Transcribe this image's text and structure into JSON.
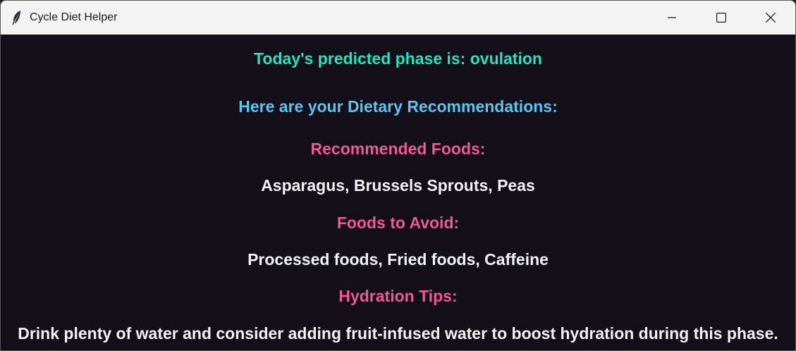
{
  "window": {
    "title": "Cycle Diet Helper",
    "icon": "feather-icon",
    "controls": [
      "minimize-icon",
      "maximize-icon",
      "close-icon"
    ]
  },
  "colors": {
    "background": "#120f18",
    "phase": "#2ee0c0",
    "heading": "#5cc6f2",
    "section_title": "#ef5a96",
    "body_text": "#f2f2f2"
  },
  "main": {
    "phase_text": "Today's predicted phase is: ovulation",
    "heading": "Here are your Dietary Recommendations:",
    "recommended_title": "Recommended Foods:",
    "recommended_items": "Asparagus, Brussels Sprouts, Peas",
    "avoid_title": "Foods to Avoid:",
    "avoid_items": "Processed foods, Fried foods, Caffeine",
    "hydration_title": "Hydration Tips:",
    "hydration_text": "Drink plenty of water and consider adding fruit-infused water to boost hydration during this phase."
  }
}
